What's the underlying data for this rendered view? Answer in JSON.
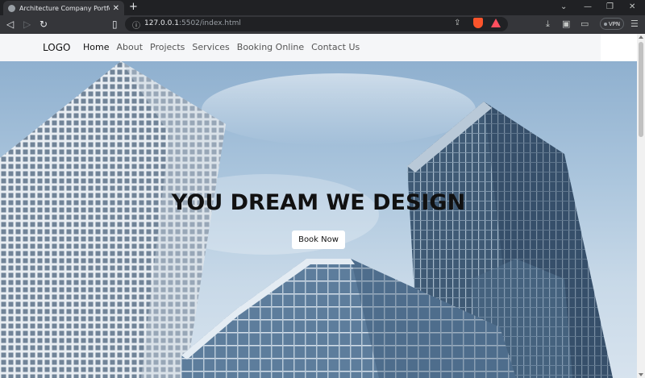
{
  "browser": {
    "tab_title": "Architecture Company Portfolio W",
    "tab_close": "✕",
    "new_tab": "+",
    "url_host": "127.0.0.1",
    "url_rest": ":5502/index.html",
    "vpn_label": "VPN",
    "icons": {
      "back": "◁",
      "forward": "▷",
      "reload": "↻",
      "bookmark": "▯",
      "info": "ⓘ",
      "share": "⇪",
      "download": "⤓",
      "sidebar": "▣",
      "wallet": "▭",
      "menu": "☰",
      "chevron": "⌄",
      "minimize": "—",
      "restore": "❐",
      "close": "✕"
    }
  },
  "site": {
    "logo": "LOGO",
    "nav": [
      "Home",
      "About",
      "Projects",
      "Services",
      "Booking Online",
      "Contact Us"
    ],
    "active_nav": "Home",
    "hero_title": "YOU DREAM WE DESIGN",
    "hero_button": "Book Now"
  }
}
